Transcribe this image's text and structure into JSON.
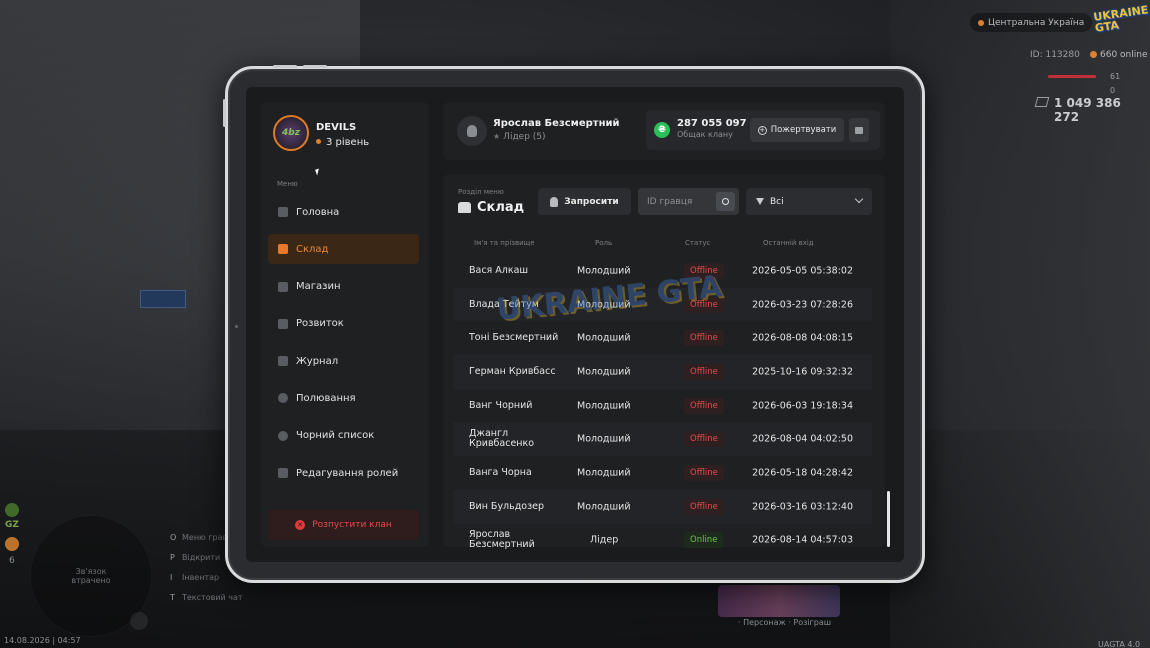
{
  "hud": {
    "region": "Центральна Україна",
    "logo": "UKRAINE GTA",
    "player_id": "ID: 113280",
    "online": "660 online",
    "hp": "61",
    "armor": "0",
    "money": "1 049 386 272",
    "map_placeholder": "Зв'язок втрачено",
    "side_label": "GZ",
    "side_count": "6",
    "hints": [
      {
        "key": "O",
        "label": "Меню гравця"
      },
      {
        "key": "P",
        "label": "Відкрити"
      },
      {
        "key": "I",
        "label": "Інвентар"
      },
      {
        "key": "T",
        "label": "Текстовий чат"
      }
    ],
    "datetime": "14.08.2026 | 04:57",
    "version": "UAGTA 4.0",
    "promo_caption": "· Персонаж · Розіграш"
  },
  "clan": {
    "logo_text": "4bz",
    "name": "DEVILS",
    "level": "3 рівень"
  },
  "menu": {
    "label": "Меню",
    "items": [
      {
        "label": "Головна",
        "icon": "home-icon"
      },
      {
        "label": "Склад",
        "icon": "members-icon",
        "active": true
      },
      {
        "label": "Магазин",
        "icon": "shop-icon"
      },
      {
        "label": "Розвиток",
        "icon": "chart-icon"
      },
      {
        "label": "Журнал",
        "icon": "book-icon"
      },
      {
        "label": "Полювання",
        "icon": "target-icon"
      },
      {
        "label": "Чорний список",
        "icon": "ban-icon"
      },
      {
        "label": "Редагування ролей",
        "icon": "user-edit-icon"
      }
    ],
    "disband_label": "Розпустити клан"
  },
  "user": {
    "name": "Ярослав Безсмертний",
    "role": "Лідер (5)"
  },
  "bank": {
    "amount": "287 055 097",
    "label": "Общак клану",
    "donate_label": "Пожертвувати"
  },
  "section": {
    "caption": "Розділ меню",
    "title": "Склад",
    "invite_label": "Запросити",
    "search_placeholder": "ID гравця",
    "filter_value": "Всі"
  },
  "table": {
    "columns": [
      "Ім'я та прізвище",
      "Роль",
      "Статус",
      "Останній вхід"
    ],
    "rows": [
      {
        "name": "Вася Алкаш",
        "role": "Молодший",
        "status": "Offline",
        "last": "2026-05-05 05:38:02"
      },
      {
        "name": "Влада Тейтум",
        "role": "Молодший",
        "status": "Offline",
        "last": "2026-03-23 07:28:26"
      },
      {
        "name": "Тоні Безсмертний",
        "role": "Молодший",
        "status": "Offline",
        "last": "2026-08-08 04:08:15"
      },
      {
        "name": "Герман Кривбасс",
        "role": "Молодший",
        "status": "Offline",
        "last": "2025-10-16 09:32:32"
      },
      {
        "name": "Ванг Чорний",
        "role": "Молодший",
        "status": "Offline",
        "last": "2026-06-03 19:18:34"
      },
      {
        "name": "Джангл Кривбасенко",
        "role": "Молодший",
        "status": "Offline",
        "last": "2026-08-04 04:02:50"
      },
      {
        "name": "Ванга Чорна",
        "role": "Молодший",
        "status": "Offline",
        "last": "2026-05-18 04:28:42"
      },
      {
        "name": "Вин Бульдозер",
        "role": "Молодший",
        "status": "Offline",
        "last": "2026-03-16 03:12:40"
      },
      {
        "name": "Ярослав Безсмертний",
        "role": "Лідер",
        "status": "Online",
        "last": "2026-08-14 04:57:03"
      }
    ]
  },
  "watermark": "UKRAINE GTA",
  "colors": {
    "accent": "#e8792a",
    "offline": "#e84a4a",
    "online": "#6cc24a",
    "bank_icon": "#2bbf5a"
  }
}
